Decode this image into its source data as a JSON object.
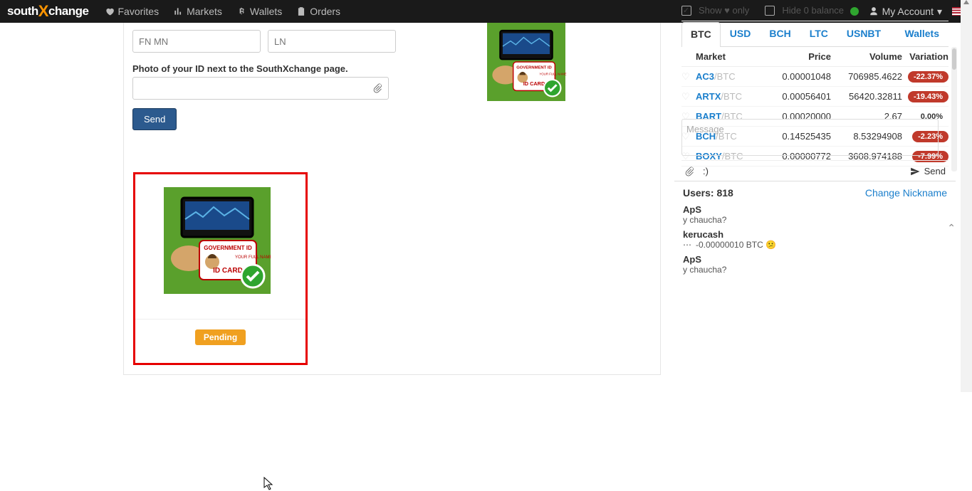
{
  "nav": {
    "brand_left": "south",
    "brand_right": "change",
    "favorites": "Favorites",
    "markets": "Markets",
    "wallets": "Wallets",
    "orders": "Orders",
    "account": "My Account"
  },
  "form": {
    "fn_placeholder": "FN MN",
    "ln_placeholder": "LN",
    "photo_label": "Photo of your ID next to the SouthXchange page.",
    "send": "Send",
    "pending": "Pending"
  },
  "filters": {
    "show_fav": "Show ♥ only",
    "hide_zero": "Hide 0 balance"
  },
  "tabs": {
    "btc": "BTC",
    "usd": "USD",
    "bch": "BCH",
    "ltc": "LTC",
    "usnbt": "USNBT",
    "wallets": "Wallets"
  },
  "market_header": {
    "market": "Market",
    "price": "Price",
    "volume": "Volume",
    "variation": "Variation"
  },
  "markets": [
    {
      "base": "AC3",
      "quote": "BTC",
      "price": "0.00001048",
      "volume": "706985.4622",
      "var": "-22.37%",
      "neg": true
    },
    {
      "base": "ARTX",
      "quote": "BTC",
      "price": "0.00056401",
      "volume": "56420.32811",
      "var": "-19.43%",
      "neg": true
    },
    {
      "base": "BART",
      "quote": "BTC",
      "price": "0.00020000",
      "volume": "2.67",
      "var": "0.00%",
      "neg": false
    },
    {
      "base": "BCH",
      "quote": "BTC",
      "price": "0.14525435",
      "volume": "8.53294908",
      "var": "-2.23%",
      "neg": true
    },
    {
      "base": "BOXY",
      "quote": "BTC",
      "price": "0.00000772",
      "volume": "3608.974188",
      "var": "-7.99%",
      "neg": true
    }
  ],
  "chat": {
    "users_label": "Users:",
    "users_count": "818",
    "nick": "Change Nickname",
    "msgs": [
      {
        "user": "ApS",
        "text": "y chaucha?"
      },
      {
        "user": "kerucash",
        "text": "-0.00000010 BTC 😕",
        "price": true
      },
      {
        "user": "ApS",
        "text": "y chaucha?"
      }
    ],
    "placeholder": "Message",
    "smile": ":)",
    "send": "Send"
  }
}
